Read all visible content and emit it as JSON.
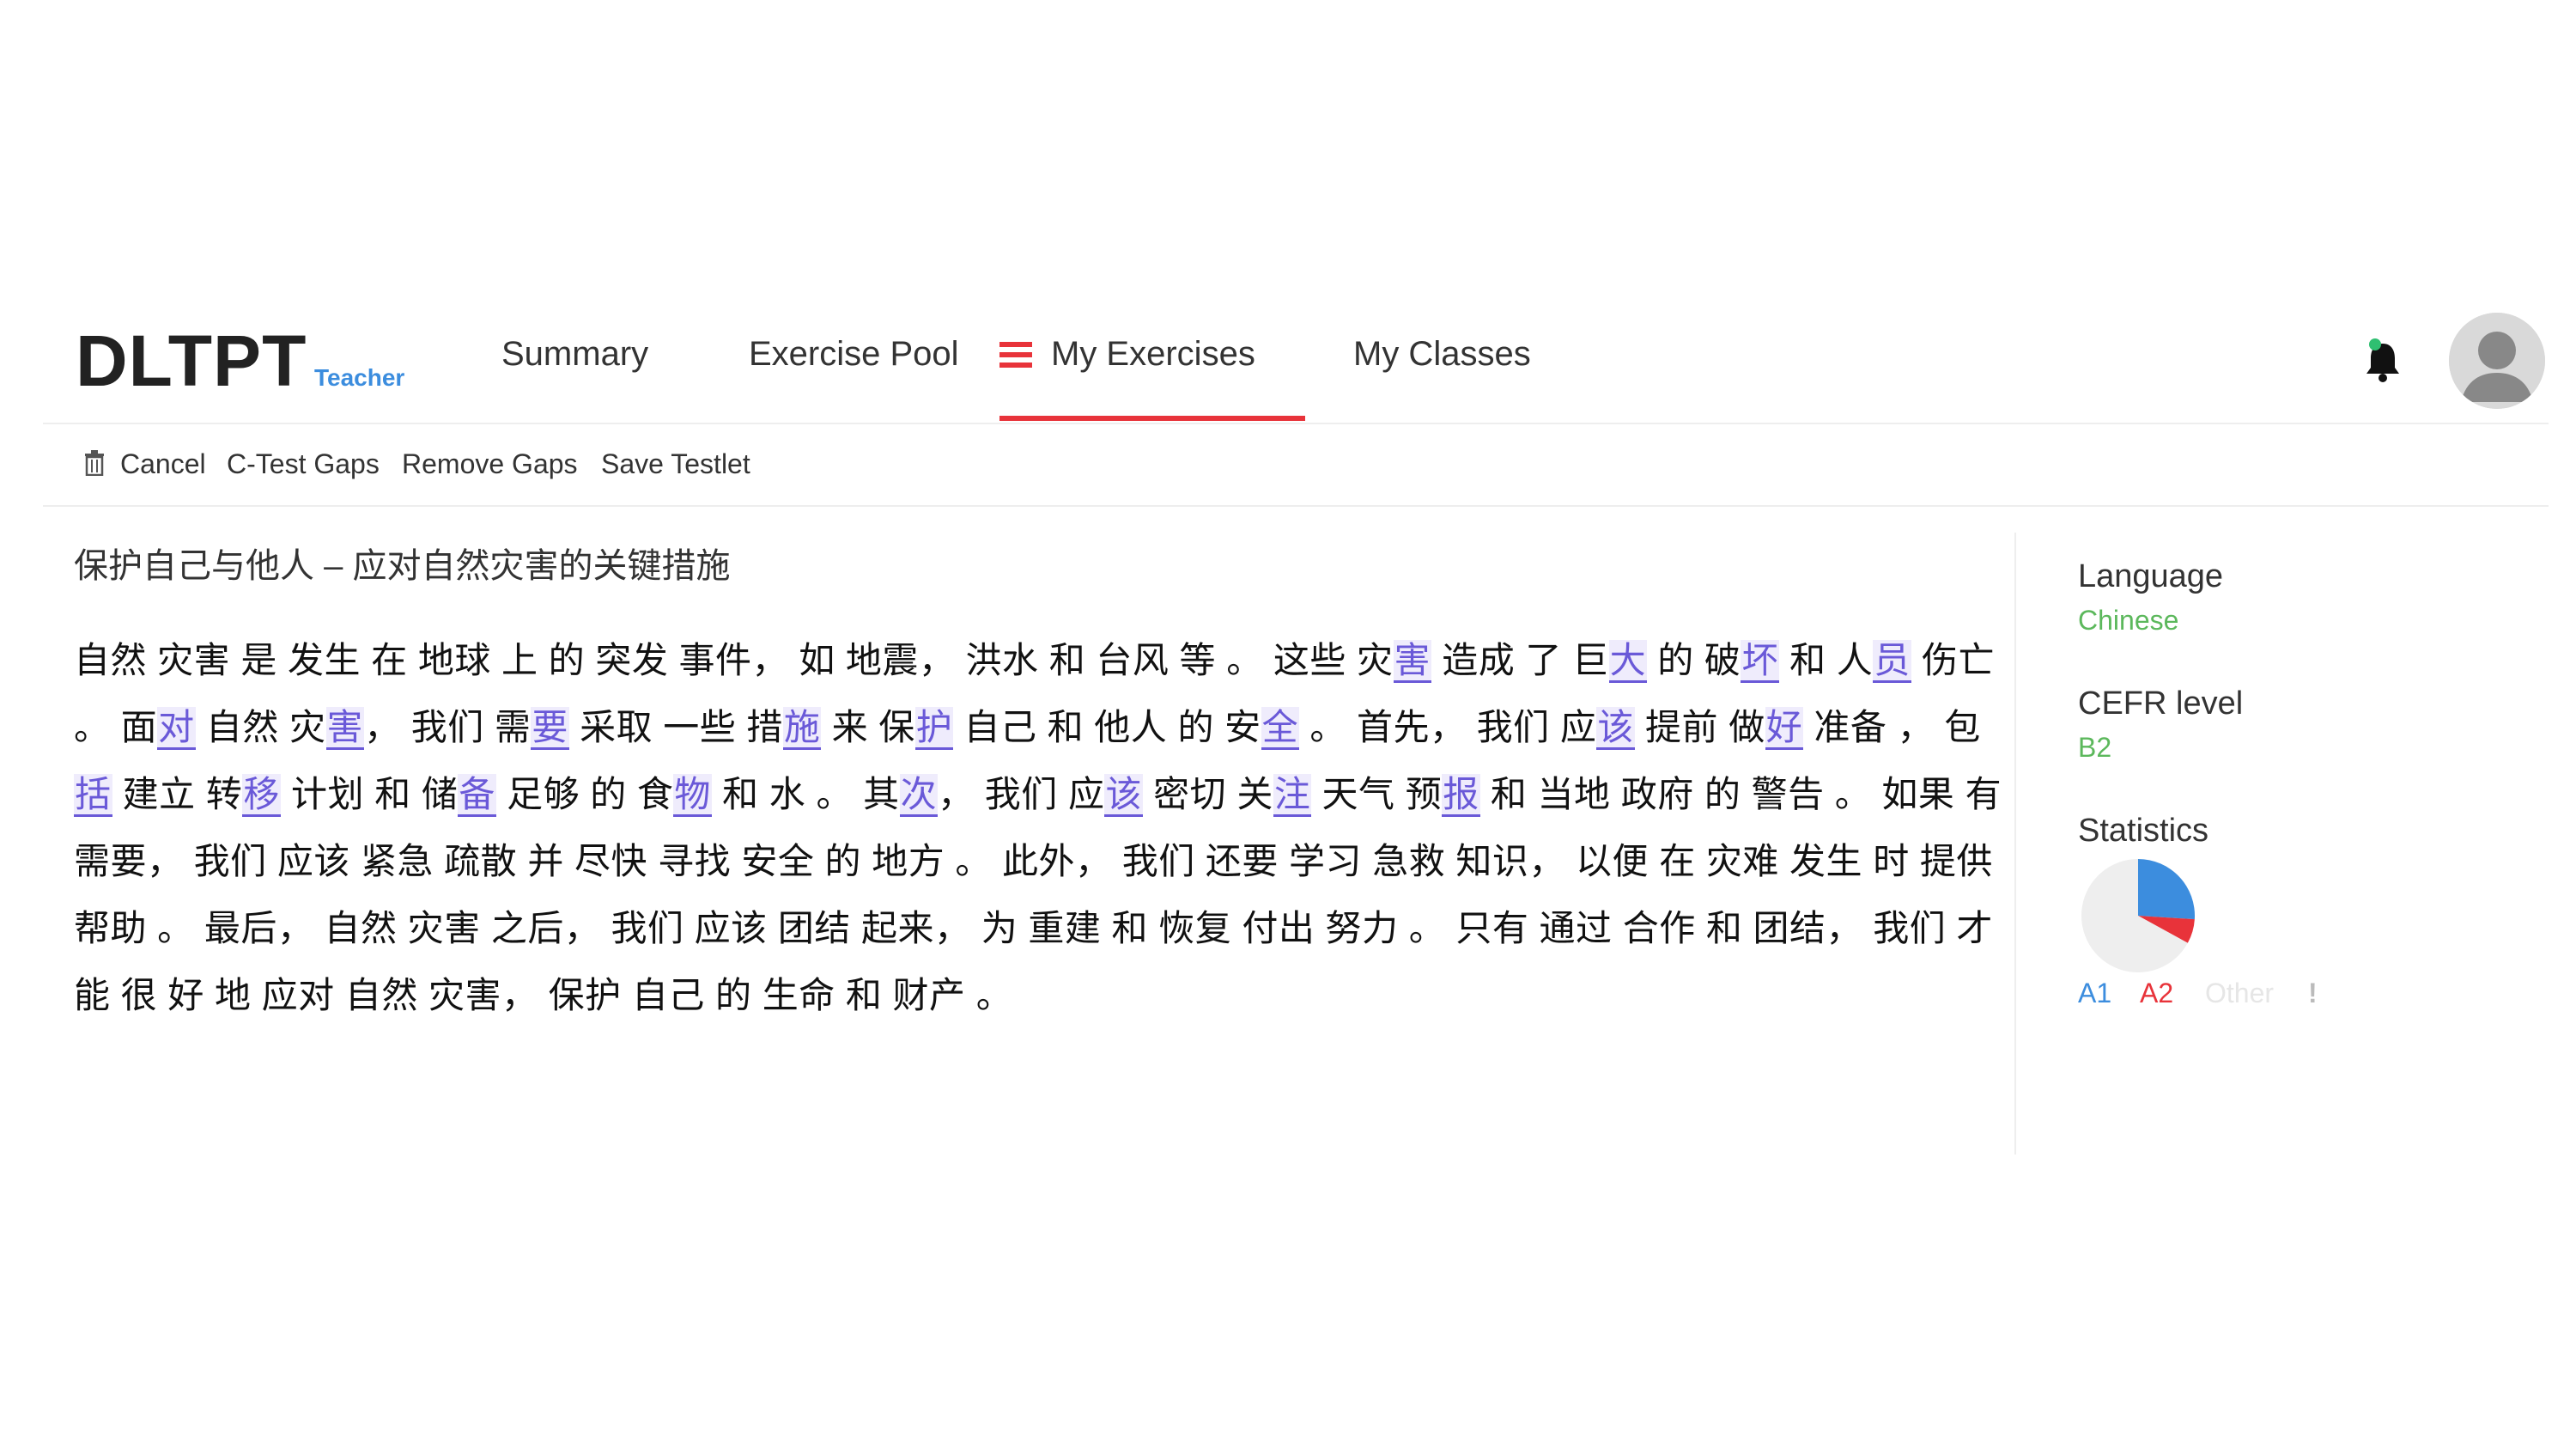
{
  "app": {
    "logo": "DLTPT",
    "role": "Teacher"
  },
  "nav": {
    "items": [
      {
        "label": "Summary"
      },
      {
        "label": "Exercise Pool"
      },
      {
        "label": "My Exercises"
      },
      {
        "label": "My Classes"
      }
    ],
    "active": "My Exercises",
    "icons": [
      "menu-icon",
      "bell-icon",
      "avatar-icon"
    ]
  },
  "toolbar": {
    "items": [
      {
        "label": "Cancel",
        "icon": "trash-icon"
      },
      {
        "label": "C-Test Gaps"
      },
      {
        "label": "Remove Gaps"
      },
      {
        "label": "Save Testlet"
      }
    ]
  },
  "testlet": {
    "title": "保护自己与他人 – 应对自然灾害的关键措施",
    "passage_segments": [
      {
        "t": "自然 灾害 是 发生 在 地球 上 的 突发 事件， 如 地震， 洪水 和 台风 等 。 这些 灾"
      },
      {
        "t": "害",
        "gap": true
      },
      {
        "t": " 造成 了 巨"
      },
      {
        "t": "大",
        "gap": true
      },
      {
        "t": " 的 破"
      },
      {
        "t": "坏",
        "gap": true
      },
      {
        "t": " 和 人"
      },
      {
        "t": "员",
        "gap": true
      },
      {
        "t": " 伤亡 。 面"
      },
      {
        "t": "对",
        "gap": true
      },
      {
        "t": " 自然 灾"
      },
      {
        "t": "害",
        "gap": true
      },
      {
        "t": "， 我们 需"
      },
      {
        "t": "要",
        "gap": true
      },
      {
        "t": " 采取 一些 措"
      },
      {
        "t": "施",
        "gap": true
      },
      {
        "t": " 来 保"
      },
      {
        "t": "护",
        "gap": true
      },
      {
        "t": " 自己 和 他人 的 安"
      },
      {
        "t": "全",
        "gap": true
      },
      {
        "t": " 。 首先， 我们 应"
      },
      {
        "t": "该",
        "gap": true
      },
      {
        "t": " 提前 做"
      },
      {
        "t": "好",
        "gap": true
      },
      {
        "t": " 准备 ， 包"
      },
      {
        "t": "括",
        "gap": true
      },
      {
        "t": " 建立 转"
      },
      {
        "t": "移",
        "gap": true
      },
      {
        "t": " 计划 和 储"
      },
      {
        "t": "备",
        "gap": true
      },
      {
        "t": " 足够 的 食"
      },
      {
        "t": "物",
        "gap": true
      },
      {
        "t": " 和 水 。 其"
      },
      {
        "t": "次",
        "gap": true
      },
      {
        "t": "， 我们 应"
      },
      {
        "t": "该",
        "gap": true
      },
      {
        "t": " 密切 关"
      },
      {
        "t": "注",
        "gap": true
      },
      {
        "t": " 天气 预"
      },
      {
        "t": "报",
        "gap": true
      },
      {
        "t": " 和 当地 政府 的 警告 。 如果 有 需要， 我们 应该 紧急 疏散 并 尽快 寻找 安全 的 地方 。 此外， 我们 还要 学习 急救 知识， 以便 在 灾难 发生 时 提供 帮助 。 最后， 自然 灾害 之后， 我们 应该 团结 起来， 为 重建 和 恢复 付出 努力 。 只有 通过 合作 和 团结， 我们 才能 很 好 地 应对 自然 灾害， 保护 自己 的 生命 和 财产 。"
      }
    ]
  },
  "sidebar": {
    "language_label": "Language",
    "language_value": "Chinese",
    "cefr_label": "CEFR level",
    "cefr_value": "B2",
    "stats_label": "Statistics",
    "legend": [
      {
        "label": "A1",
        "color": "#3c8dde"
      },
      {
        "label": "A2",
        "color": "#e8333a"
      },
      {
        "label": "Other",
        "color": "#e6e6e6"
      },
      {
        "label": "!",
        "color": "#bbbbbb"
      }
    ]
  },
  "chart_data": {
    "type": "pie",
    "categories": [
      "A1",
      "A2",
      "Other"
    ],
    "values": [
      26,
      7,
      67
    ],
    "colors": [
      "#3c8dde",
      "#e8333a",
      "#eeeeee"
    ],
    "legend_position": "bottom"
  }
}
